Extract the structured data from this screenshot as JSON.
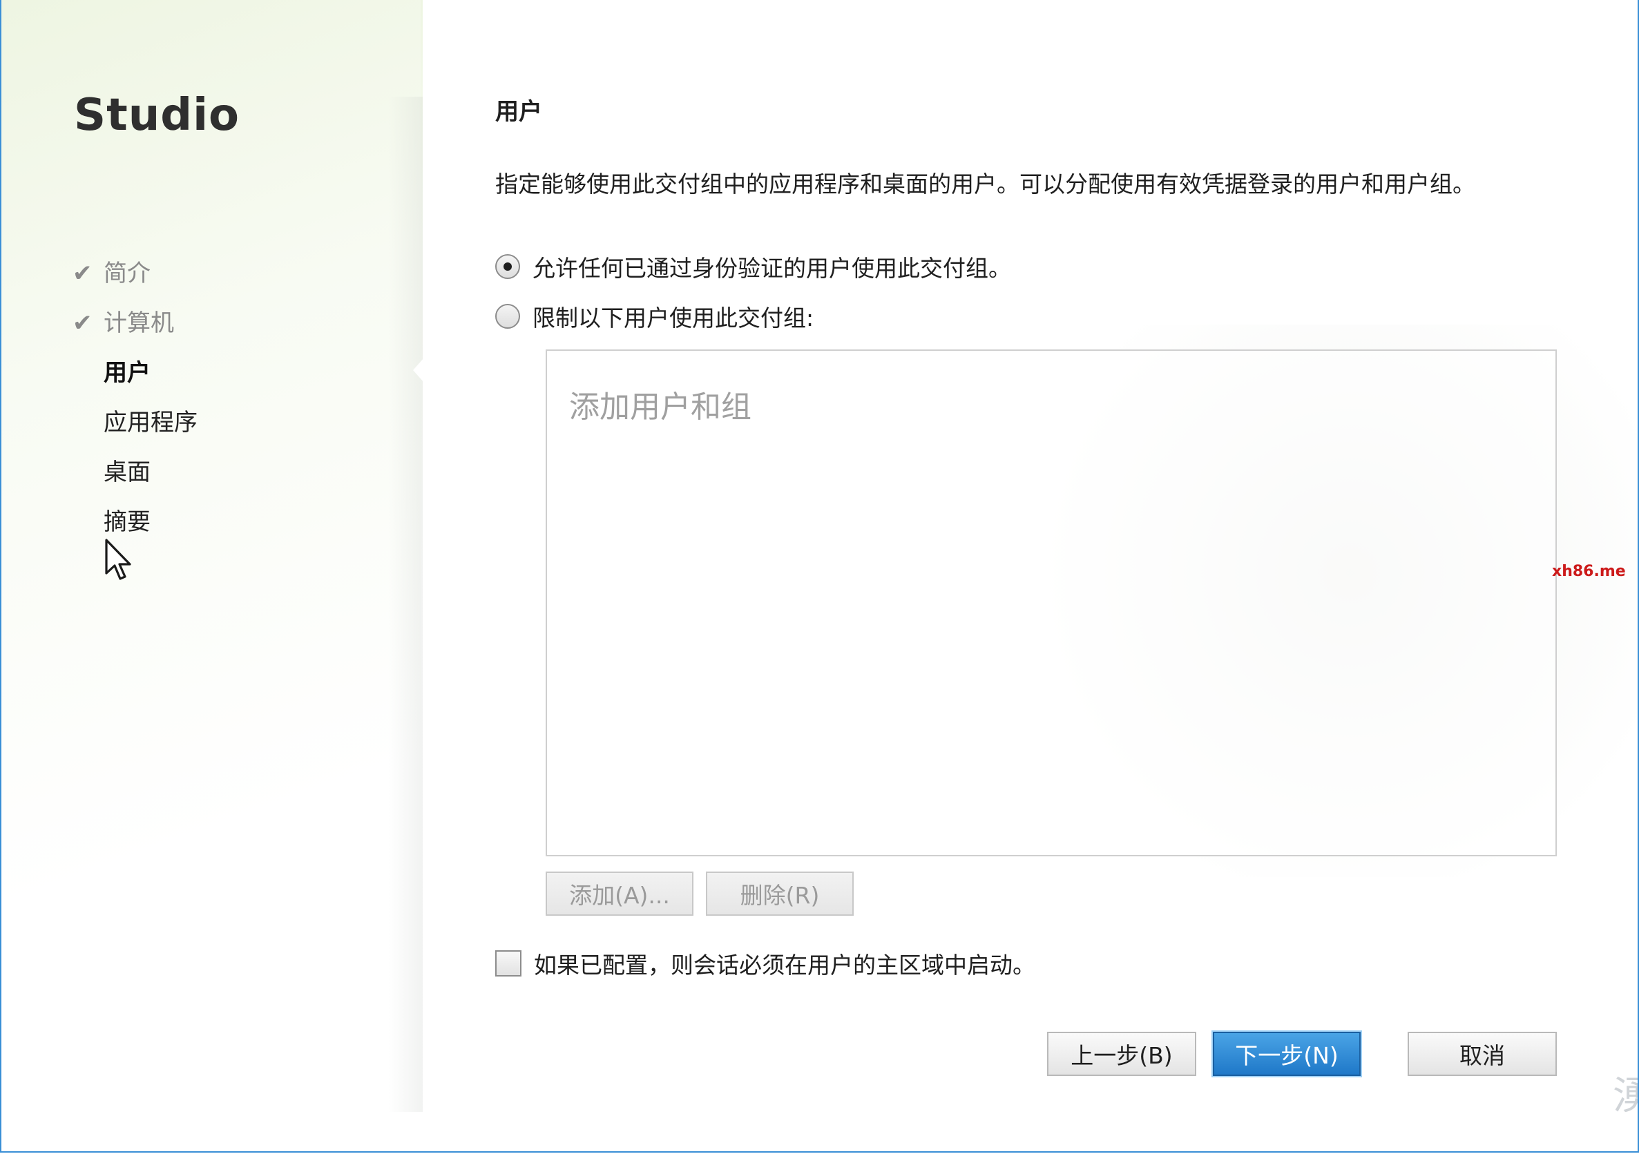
{
  "sidebar": {
    "app_title": "Studio",
    "steps": [
      {
        "label": "简介",
        "state": "done"
      },
      {
        "label": "计算机",
        "state": "done"
      },
      {
        "label": "用户",
        "state": "current"
      },
      {
        "label": "应用程序",
        "state": "pending"
      },
      {
        "label": "桌面",
        "state": "pending"
      },
      {
        "label": "摘要",
        "state": "pending"
      }
    ],
    "check_icon": "✔"
  },
  "main": {
    "title": "用户",
    "description": "指定能够使用此交付组中的应用程序和桌面的用户。可以分配使用有效凭据登录的用户和用户组。",
    "options": {
      "allow_any": {
        "label": "允许任何已通过身份验证的用户使用此交付组。",
        "checked": true
      },
      "restrict": {
        "label": "限制以下用户使用此交付组:",
        "checked": false
      }
    },
    "user_list": {
      "placeholder": "添加用户和组",
      "value": ""
    },
    "add_button": "添加(A)...",
    "remove_button": "删除(R)",
    "home_zone_checkbox": {
      "label": "如果已配置，则会话必须在用户的主区域中启动。",
      "checked": false
    }
  },
  "footer": {
    "back_button": "上一步(B)",
    "next_button": "下一步(N)",
    "cancel_button": "取消"
  },
  "overlay": {
    "site_mark": "xh86.me",
    "corner_glyph": "湧"
  },
  "colors": {
    "primary_button": "#1f78c8",
    "window_border": "#3a8fd6",
    "site_mark": "#cc1a1a"
  }
}
